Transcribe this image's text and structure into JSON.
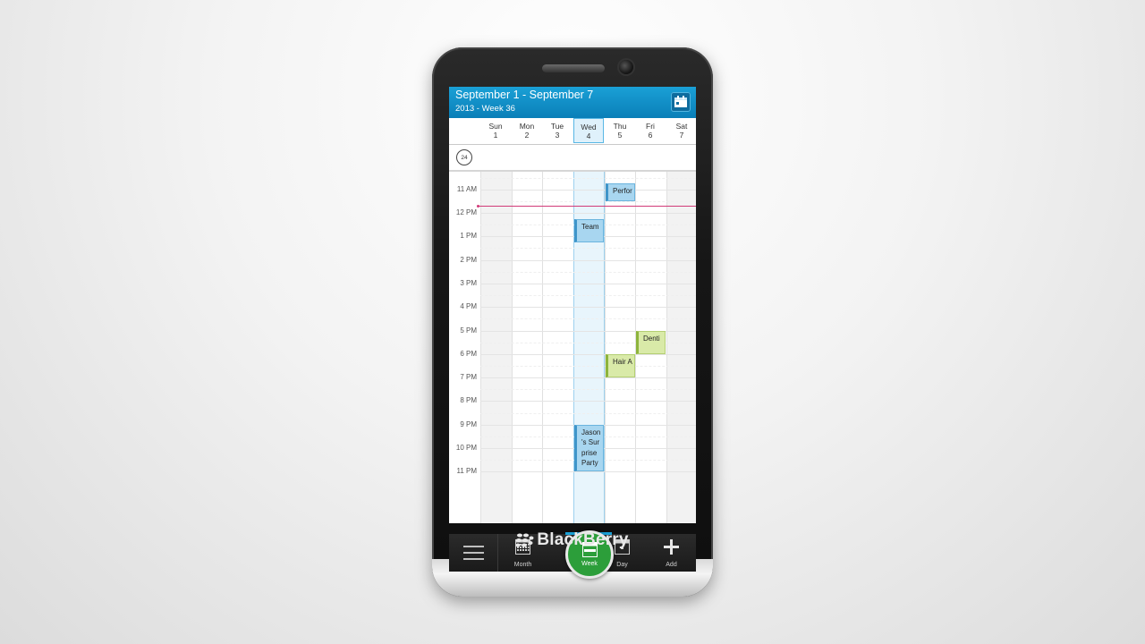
{
  "device": {
    "brand": "BlackBerry"
  },
  "calendar": {
    "title": "September 1 - September 7",
    "subtitle": "2013 - Week 36",
    "days": [
      {
        "name": "Sun",
        "num": "1"
      },
      {
        "name": "Mon",
        "num": "2"
      },
      {
        "name": "Tue",
        "num": "3"
      },
      {
        "name": "Wed",
        "num": "4"
      },
      {
        "name": "Thu",
        "num": "5"
      },
      {
        "name": "Fri",
        "num": "6"
      },
      {
        "name": "Sat",
        "num": "7"
      }
    ],
    "today_index": 3,
    "timezone_icon_label": "24",
    "hours": [
      "11 AM",
      "12 PM",
      "1 PM",
      "2 PM",
      "3 PM",
      "4 PM",
      "5 PM",
      "6 PM",
      "7 PM",
      "8 PM",
      "9 PM",
      "10 PM",
      "11 PM"
    ],
    "events": [
      {
        "title": "Perfor",
        "day_index": 4,
        "start_hour": 10.75,
        "end_hour": 11.5,
        "color": "blue"
      },
      {
        "title": "Team",
        "day_index": 3,
        "start_hour": 12.25,
        "end_hour": 13.25,
        "color": "blue"
      },
      {
        "title": "Denti",
        "day_index": 5,
        "start_hour": 17.0,
        "end_hour": 18.0,
        "color": "green"
      },
      {
        "title": "Hair A",
        "day_index": 4,
        "start_hour": 18.0,
        "end_hour": 19.0,
        "color": "green"
      },
      {
        "title": "Jason 's Sur prise Party",
        "day_index": 3,
        "start_hour": 21.0,
        "end_hour": 23.0,
        "color": "blue"
      }
    ],
    "now_hour": 11.7
  },
  "actionbar": {
    "items": [
      {
        "label": "Month",
        "icon": "month-grid-icon"
      },
      {
        "label": "Week",
        "icon": "week-icon",
        "active": true
      },
      {
        "label": "Day",
        "icon": "day-icon"
      },
      {
        "label": "Add",
        "icon": "plus-icon"
      }
    ]
  },
  "colors": {
    "title_bar": "#1aa0d6",
    "event_blue": "#a8d6f0",
    "event_green": "#d9eaa8",
    "now_line": "#d13a78",
    "active_action": "#2c9e3a"
  }
}
